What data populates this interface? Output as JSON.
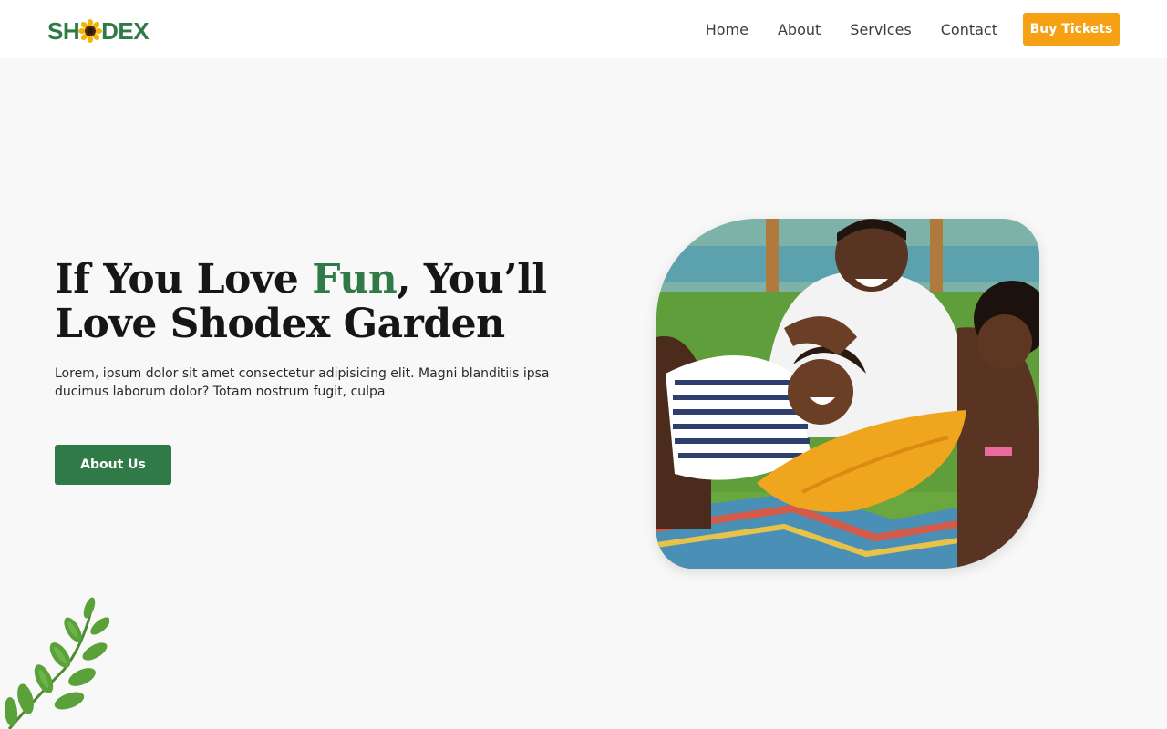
{
  "brand": {
    "logo_prefix": "SH",
    "logo_suffix": "DEX",
    "logo_icon": "sunflower-icon",
    "primary_color": "#2f7a47",
    "accent_color": "#f5a113"
  },
  "nav": {
    "items": [
      {
        "label": "Home"
      },
      {
        "label": "About"
      },
      {
        "label": "Services"
      },
      {
        "label": "Contact"
      }
    ],
    "cta_label": "Buy Tickets"
  },
  "hero": {
    "title_part1": "If You Love ",
    "title_accent": "Fun",
    "title_part2": ", You’ll Love Shodex Garden",
    "description": "Lorem, ipsum dolor sit amet consectetur adipisicing elit. Magni blanditiis ipsa ducimus laborum dolor? Totam nostrum fugit, culpa",
    "button_label": "About Us"
  }
}
